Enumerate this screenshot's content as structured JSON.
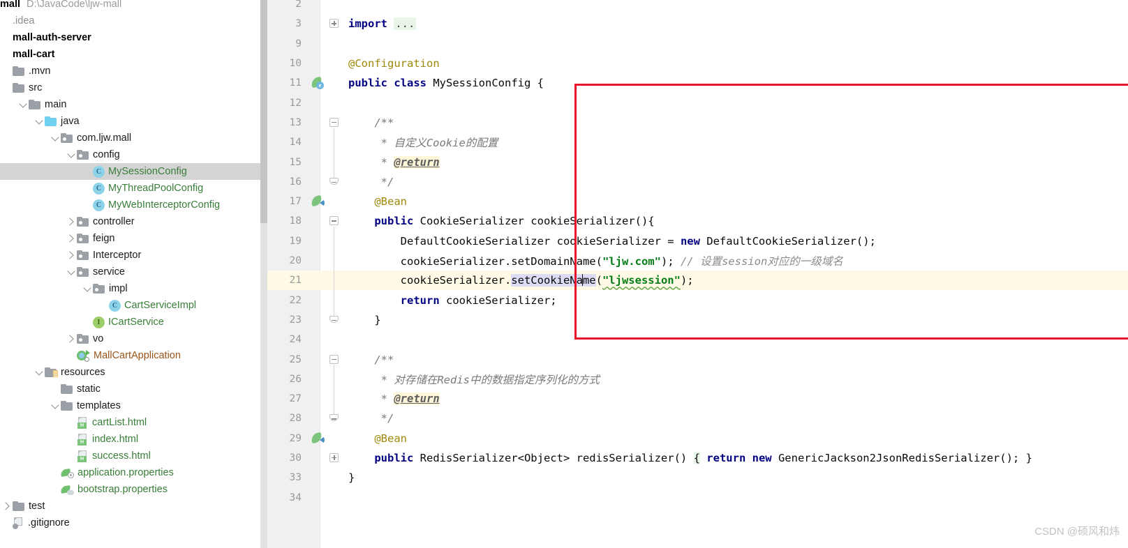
{
  "project": {
    "root_label": "mall",
    "root_path": "D:\\JavaCode\\ljw-mall",
    "tree": [
      {
        "label": ".idea",
        "kind": "folder-dim",
        "indent": 0,
        "chevron": "none",
        "selected": false
      },
      {
        "label": "mall-auth-server",
        "kind": "module",
        "indent": 0,
        "chevron": "none",
        "selected": false
      },
      {
        "label": "mall-cart",
        "kind": "module",
        "indent": 0,
        "chevron": "none",
        "selected": false
      },
      {
        "label": ".mvn",
        "kind": "folder",
        "indent": 0,
        "chevron": "none",
        "selected": false
      },
      {
        "label": "src",
        "kind": "folder",
        "indent": 0,
        "chevron": "none",
        "selected": false
      },
      {
        "label": "main",
        "kind": "folder",
        "indent": 1,
        "chevron": "down",
        "selected": false
      },
      {
        "label": "java",
        "kind": "folder-blue",
        "indent": 2,
        "chevron": "down",
        "selected": false
      },
      {
        "label": "com.ljw.mall",
        "kind": "package",
        "indent": 3,
        "chevron": "down",
        "selected": false
      },
      {
        "label": "config",
        "kind": "package",
        "indent": 4,
        "chevron": "down",
        "selected": false
      },
      {
        "label": "MySessionConfig",
        "kind": "class",
        "indent": 5,
        "chevron": "none",
        "selected": true
      },
      {
        "label": "MyThreadPoolConfig",
        "kind": "class",
        "indent": 5,
        "chevron": "none",
        "selected": false
      },
      {
        "label": "MyWebInterceptorConfig",
        "kind": "class",
        "indent": 5,
        "chevron": "none",
        "selected": false
      },
      {
        "label": "controller",
        "kind": "package",
        "indent": 4,
        "chevron": "right",
        "selected": false
      },
      {
        "label": "feign",
        "kind": "package",
        "indent": 4,
        "chevron": "right",
        "selected": false
      },
      {
        "label": "Interceptor",
        "kind": "package",
        "indent": 4,
        "chevron": "right",
        "selected": false
      },
      {
        "label": "service",
        "kind": "package",
        "indent": 4,
        "chevron": "down",
        "selected": false
      },
      {
        "label": "impl",
        "kind": "package",
        "indent": 5,
        "chevron": "down",
        "selected": false
      },
      {
        "label": "CartServiceImpl",
        "kind": "class",
        "indent": 6,
        "chevron": "none",
        "selected": false
      },
      {
        "label": "ICartService",
        "kind": "interface",
        "indent": 5,
        "chevron": "none",
        "selected": false
      },
      {
        "label": "vo",
        "kind": "package",
        "indent": 4,
        "chevron": "right",
        "selected": false
      },
      {
        "label": "MallCartApplication",
        "kind": "spring-app",
        "indent": 4,
        "chevron": "none",
        "selected": false
      },
      {
        "label": "resources",
        "kind": "resources",
        "indent": 2,
        "chevron": "down",
        "selected": false
      },
      {
        "label": "static",
        "kind": "folder",
        "indent": 3,
        "chevron": "none",
        "selected": false
      },
      {
        "label": "templates",
        "kind": "folder",
        "indent": 3,
        "chevron": "down",
        "selected": false
      },
      {
        "label": "cartList.html",
        "kind": "html",
        "indent": 4,
        "chevron": "none",
        "selected": false
      },
      {
        "label": "index.html",
        "kind": "html",
        "indent": 4,
        "chevron": "none",
        "selected": false
      },
      {
        "label": "success.html",
        "kind": "html",
        "indent": 4,
        "chevron": "none",
        "selected": false
      },
      {
        "label": "application.properties",
        "kind": "properties",
        "indent": 3,
        "chevron": "none",
        "selected": false
      },
      {
        "label": "bootstrap.properties",
        "kind": "properties-cloud",
        "indent": 3,
        "chevron": "none",
        "selected": false
      },
      {
        "label": "test",
        "kind": "folder",
        "indent": 0,
        "chevron": "right",
        "selected": false
      },
      {
        "label": ".gitignore",
        "kind": "gitignore",
        "indent": 0,
        "chevron": "none",
        "selected": false
      }
    ]
  },
  "editor": {
    "file": "MySessionConfig",
    "current_line": 21,
    "lines": [
      {
        "num": "2",
        "indent": 0,
        "tokens": []
      },
      {
        "num": "3",
        "indent": 0,
        "fold": "collapsed-import",
        "tokens": [
          {
            "t": "import",
            "c": "kw"
          },
          {
            "t": " ",
            "c": ""
          },
          {
            "t": "...",
            "c": "fold-dots"
          }
        ]
      },
      {
        "num": "9",
        "indent": 0,
        "tokens": []
      },
      {
        "num": "10",
        "indent": 0,
        "tokens": [
          {
            "t": "@Configuration",
            "c": "ann"
          }
        ]
      },
      {
        "num": "11",
        "indent": 0,
        "gutter_icon": "spring-bean",
        "tokens": [
          {
            "t": "public",
            "c": "kw"
          },
          {
            "t": " ",
            "c": ""
          },
          {
            "t": "class",
            "c": "kw"
          },
          {
            "t": " MySessionConfig {",
            "c": ""
          }
        ]
      },
      {
        "num": "12",
        "indent": 0,
        "tokens": []
      },
      {
        "num": "13",
        "indent": 1,
        "fold": "start",
        "tokens": [
          {
            "t": "/**",
            "c": "cmt-doc"
          }
        ]
      },
      {
        "num": "14",
        "indent": 1,
        "tokens": [
          {
            "t": " * ",
            "c": "cmt-doc"
          },
          {
            "t": "自定义Cookie的配置",
            "c": "cmt-doc"
          }
        ]
      },
      {
        "num": "15",
        "indent": 1,
        "tokens": [
          {
            "t": " * ",
            "c": "cmt-doc"
          },
          {
            "t": "@return",
            "c": "tag"
          }
        ]
      },
      {
        "num": "16",
        "indent": 1,
        "fold": "end",
        "tokens": [
          {
            "t": " */",
            "c": "cmt-doc"
          }
        ]
      },
      {
        "num": "17",
        "indent": 1,
        "gutter_icon": "spring-arrow",
        "tokens": [
          {
            "t": "@Bean",
            "c": "ann"
          }
        ]
      },
      {
        "num": "18",
        "indent": 1,
        "fold": "start",
        "tokens": [
          {
            "t": "public",
            "c": "kw"
          },
          {
            "t": " CookieSerializer cookieSerializer(){",
            "c": ""
          }
        ]
      },
      {
        "num": "19",
        "indent": 2,
        "tokens": [
          {
            "t": "DefaultCookieSerializer cookieSerializer = ",
            "c": ""
          },
          {
            "t": "new",
            "c": "kw"
          },
          {
            "t": " DefaultCookieSerializer();",
            "c": ""
          }
        ]
      },
      {
        "num": "20",
        "indent": 2,
        "tokens": [
          {
            "t": "cookieSerializer.setDomainName(",
            "c": ""
          },
          {
            "t": "\"ljw.com\"",
            "c": "str"
          },
          {
            "t": "); ",
            "c": ""
          },
          {
            "t": "// 设置session对应的一级域名",
            "c": "cmt"
          }
        ]
      },
      {
        "num": "21",
        "indent": 2,
        "current": true,
        "tokens": [
          {
            "t": "cookieSerializer.",
            "c": ""
          },
          {
            "t": "setCookieNa",
            "c": "ident-hl"
          },
          {
            "t": "|CARET|",
            "c": "caret"
          },
          {
            "t": "me",
            "c": "ident-hl"
          },
          {
            "t": "(",
            "c": ""
          },
          {
            "t": "\"ljwsession\"",
            "c": "str squiggle"
          },
          {
            "t": ");",
            "c": ""
          }
        ]
      },
      {
        "num": "22",
        "indent": 2,
        "tokens": [
          {
            "t": "return",
            "c": "kw"
          },
          {
            "t": " cookieSerializer;",
            "c": ""
          }
        ]
      },
      {
        "num": "23",
        "indent": 1,
        "fold": "end",
        "tokens": [
          {
            "t": "}",
            "c": ""
          }
        ]
      },
      {
        "num": "24",
        "indent": 0,
        "tokens": []
      },
      {
        "num": "25",
        "indent": 1,
        "fold": "start",
        "tokens": [
          {
            "t": "/**",
            "c": "cmt-doc"
          }
        ]
      },
      {
        "num": "26",
        "indent": 1,
        "tokens": [
          {
            "t": " * ",
            "c": "cmt-doc"
          },
          {
            "t": "对存储在Redis中的数据指定序列化的方式",
            "c": "cmt-doc"
          }
        ]
      },
      {
        "num": "27",
        "indent": 1,
        "tokens": [
          {
            "t": " * ",
            "c": "cmt-doc"
          },
          {
            "t": "@return",
            "c": "tag"
          }
        ]
      },
      {
        "num": "28",
        "indent": 1,
        "fold": "end",
        "tokens": [
          {
            "t": " */",
            "c": "cmt-doc"
          }
        ]
      },
      {
        "num": "29",
        "indent": 1,
        "gutter_icon": "spring-arrow",
        "tokens": [
          {
            "t": "@Bean",
            "c": "ann"
          }
        ]
      },
      {
        "num": "30",
        "indent": 1,
        "fold": "collapsed-method",
        "tokens": [
          {
            "t": "public",
            "c": "kw"
          },
          {
            "t": " RedisSerializer<Object> redisSerializer() ",
            "c": ""
          },
          {
            "t": "{",
            "c": "fold-brace"
          },
          {
            "t": " ",
            "c": ""
          },
          {
            "t": "return",
            "c": "kw"
          },
          {
            "t": " ",
            "c": ""
          },
          {
            "t": "new",
            "c": "kw"
          },
          {
            "t": " GenericJackson2JsonRedisSerializer(); }",
            "c": ""
          }
        ]
      },
      {
        "num": "33",
        "indent": 0,
        "tokens": [
          {
            "t": "}",
            "c": ""
          }
        ]
      },
      {
        "num": "34",
        "indent": 0,
        "tokens": []
      }
    ]
  },
  "watermark": "CSDN @硕风和炜",
  "colors": {
    "annotation_rect": "#e8152a",
    "current_line": "#fffae6",
    "selection": "#d4d4d4",
    "keyword": "#000081",
    "string": "#067d17",
    "annotation": "#9e880d",
    "comment": "#8c8c8c"
  }
}
